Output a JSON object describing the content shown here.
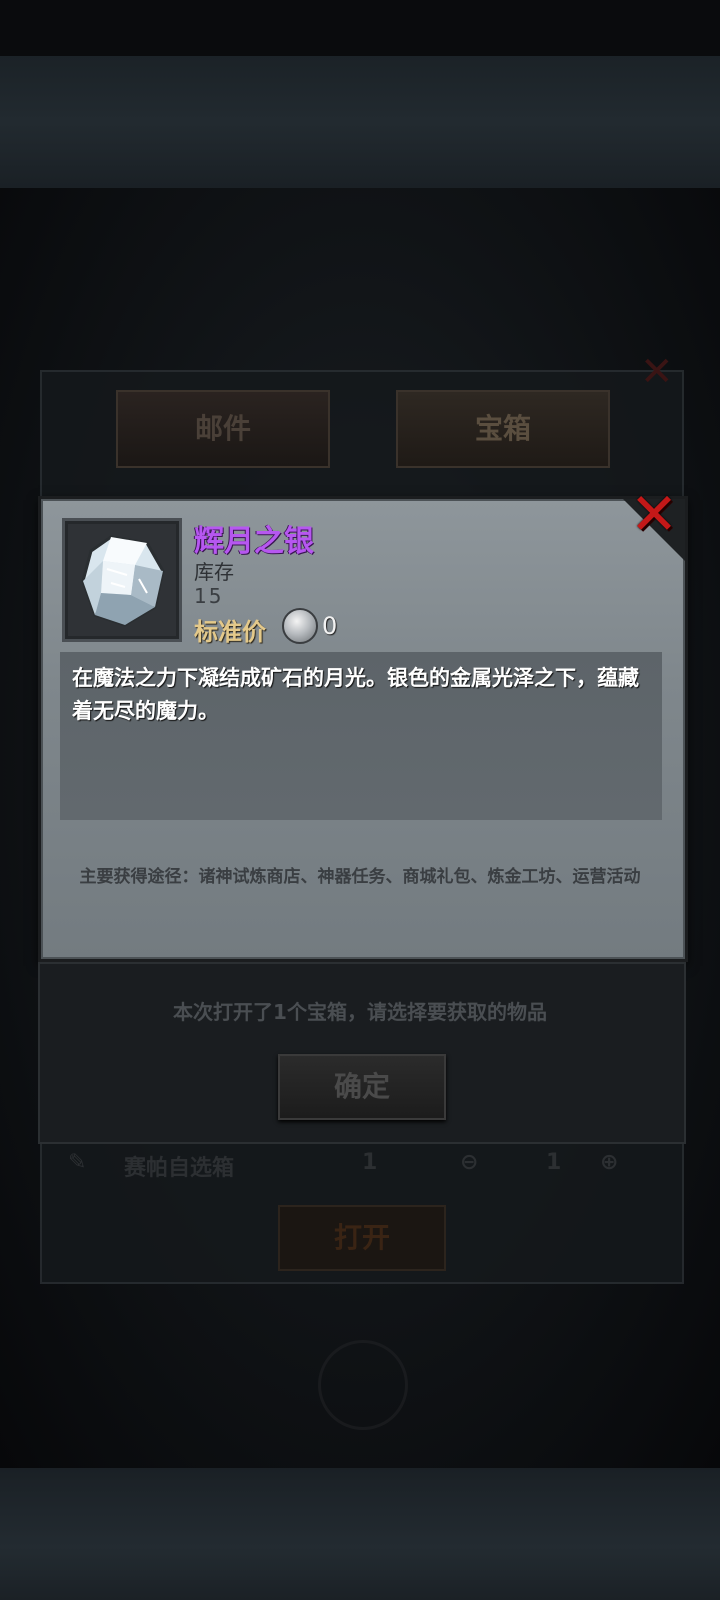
{
  "background": {
    "tabs": [
      "邮件",
      "宝箱"
    ],
    "row": {
      "name": "赛帕自选箱",
      "count": "1",
      "qty": "1"
    },
    "open_button": "打开"
  },
  "item": {
    "name": "辉月之银",
    "stock_label": "库存",
    "stock_value": "15",
    "price_label": "标准价",
    "price_value": "0",
    "description": "在魔法之力下凝结成矿石的月光。银色的金属光泽之下，蕴藏着无尽的魔力。",
    "source": "主要获得途径：诸神试炼商店、神器任务、商城礼包、炼金工坊、运营活动"
  },
  "confirm": {
    "message": "本次打开了1个宝箱，请选择要获取的物品",
    "button": "确定"
  },
  "colors": {
    "item_name": "#b657f0",
    "close": "#c41818",
    "price_label": "#e4c98a"
  }
}
